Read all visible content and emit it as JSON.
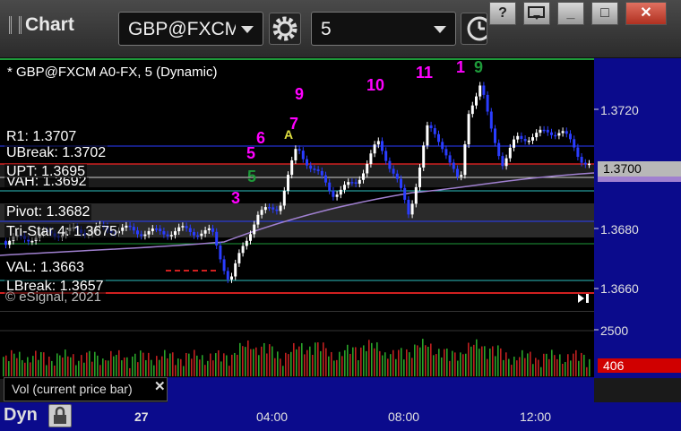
{
  "window": {
    "title": "Chart",
    "buttons": {
      "help": "?",
      "min": "_",
      "max": "□",
      "close": "✕"
    }
  },
  "toolbar": {
    "symbol_value": "GBP@FXCM",
    "interval_value": "5"
  },
  "chart": {
    "title": "* GBP@FXCM A0-FX, 5 (Dynamic)",
    "copyright": "© eSignal, 2021",
    "current_price": "1.3700",
    "current_volume": "406",
    "vol_legend": "Vol (current price bar)",
    "vol_close": "✕",
    "mode": "Dyn",
    "levels": [
      {
        "label": "R1: 1.3707"
      },
      {
        "label": "UBreak: 1.3702"
      },
      {
        "label": "UPT: 1.3695"
      },
      {
        "label": "VAH: 1.3692"
      },
      {
        "label": "Pivot: 1.3682"
      },
      {
        "label": "Tri-Star 4: 1.3675"
      },
      {
        "label": "VAL: 1.3663"
      },
      {
        "label": "LBreak: 1.3657"
      }
    ],
    "price_ticks": [
      "1.3720",
      "1.3680",
      "1.3660"
    ],
    "vol_ticks": [
      "2500"
    ],
    "time_ticks": [
      "27",
      "04:00",
      "08:00",
      "12:00"
    ],
    "wave_labels": [
      "3",
      "5",
      "6",
      "7",
      "9",
      "10",
      "11",
      "1",
      "A",
      "5",
      "9"
    ],
    "colors": {
      "candle_up": "#ffffff",
      "candle_down": "#2a3dff",
      "wave_magenta": "#ff00ff",
      "wave_green": "#1e9a3a",
      "axis_blue": "#0b0b8c"
    }
  }
}
